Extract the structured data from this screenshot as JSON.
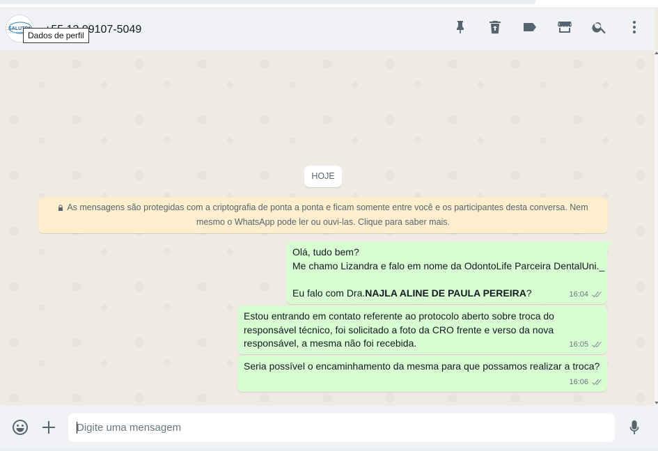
{
  "header": {
    "contact_name": "+55 12 99107-5049",
    "avatar_text": "SALUTON",
    "tooltip": "Dados de perfil",
    "icons": [
      "pin-icon",
      "trash-icon",
      "label-icon",
      "store-icon",
      "search-icon",
      "menu-dots-icon"
    ]
  },
  "chat": {
    "date_chip": "HOJE",
    "encryption_notice": {
      "line1": "As mensagens são protegidas com a criptografia de ponta a ponta e ficam somente entre você e os participantes desta conversa. Nem",
      "line2": "mesmo o WhatsApp pode ler ou ouvi-las. Clique para saber mais."
    },
    "messages": [
      {
        "lines": [
          "Olá, tudo bem?",
          "Me chamo Lizandra e falo em nome da OdontoLife Parceira DentalUni._",
          ""
        ],
        "last_prefix": "Eu falo com Dra.",
        "last_bold": "NAJLA ALINE DE PAULA PEREIRA",
        "last_suffix": "?",
        "time": "16:04",
        "status": "double-check-icon"
      },
      {
        "text": "Estou entrando em contato referente ao protocolo aberto sobre troca do responsável técnico, foi solicitado a foto da CRO frente e verso da nova responsável, a mesma não foi recebida.",
        "time": "16:05",
        "status": "double-check-icon"
      },
      {
        "text": "Seria possível o encaminhamento da mesma para que possamos realizar a troca?",
        "time": "16:06",
        "status": "double-check-icon"
      }
    ]
  },
  "footer": {
    "placeholder": "Digite uma mensagem",
    "icons": [
      "emoji-icon",
      "plus-icon",
      "microphone-icon"
    ]
  },
  "colors": {
    "outgoing_bubble": "#d9fdd3",
    "chat_background": "#efeae2",
    "encryption_bg": "#ffeecd",
    "header_bg": "#f0f2f5"
  }
}
